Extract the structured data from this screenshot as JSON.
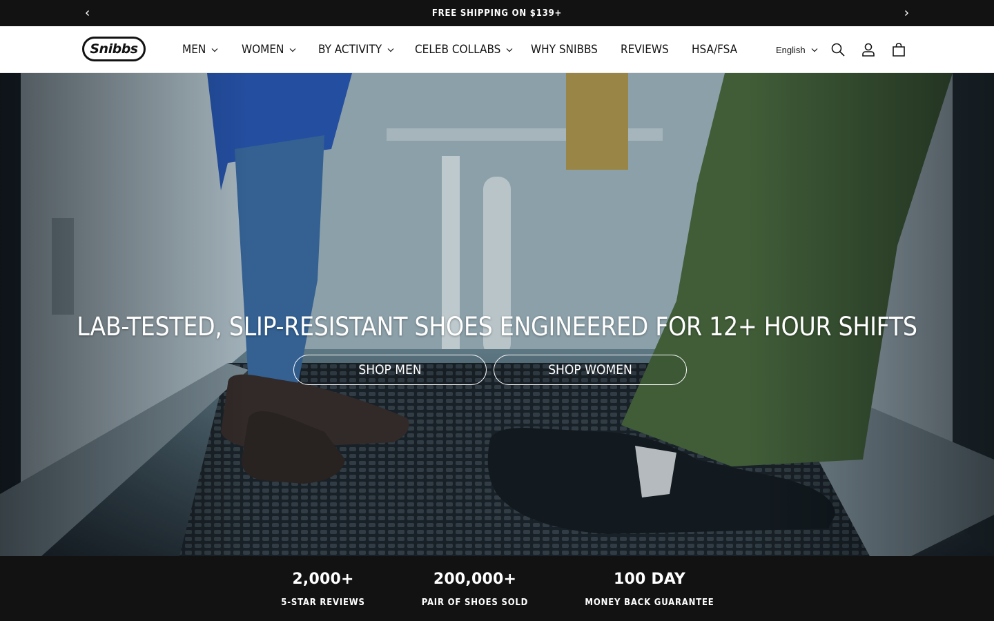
{
  "announcement": {
    "text": "FREE SHIPPING ON $139+",
    "prev_icon": "chevron-left-icon",
    "next_icon": "chevron-right-icon"
  },
  "header": {
    "logo_text": "Snibbs",
    "nav": [
      {
        "label": "MEN",
        "has_dropdown": true
      },
      {
        "label": "WOMEN",
        "has_dropdown": true
      },
      {
        "label": "BY ACTIVITY",
        "has_dropdown": true
      },
      {
        "label": "CELEB COLLABS",
        "has_dropdown": true
      },
      {
        "label": "WHY SNIBBS",
        "has_dropdown": false
      },
      {
        "label": "REVIEWS",
        "has_dropdown": false
      },
      {
        "label": "HSA/FSA",
        "has_dropdown": false
      }
    ],
    "language": "English",
    "icons": [
      "search-icon",
      "account-icon",
      "cart-icon"
    ]
  },
  "hero": {
    "title": "LAB-TESTED, SLIP-RESISTANT SHOES ENGINEERED FOR 12+ HOUR SHIFTS",
    "shop_men_label": "SHOP MEN",
    "shop_women_label": "SHOP WOMEN"
  },
  "stats": [
    {
      "value": "2,000+",
      "label": "5-STAR REVIEWS"
    },
    {
      "value": "200,000+",
      "label": "PAIR OF SHOES SOLD"
    },
    {
      "value": "100 DAY",
      "label": "MONEY BACK GUARANTEE"
    }
  ],
  "colors": {
    "dark": "#121212",
    "white": "#ffffff"
  }
}
